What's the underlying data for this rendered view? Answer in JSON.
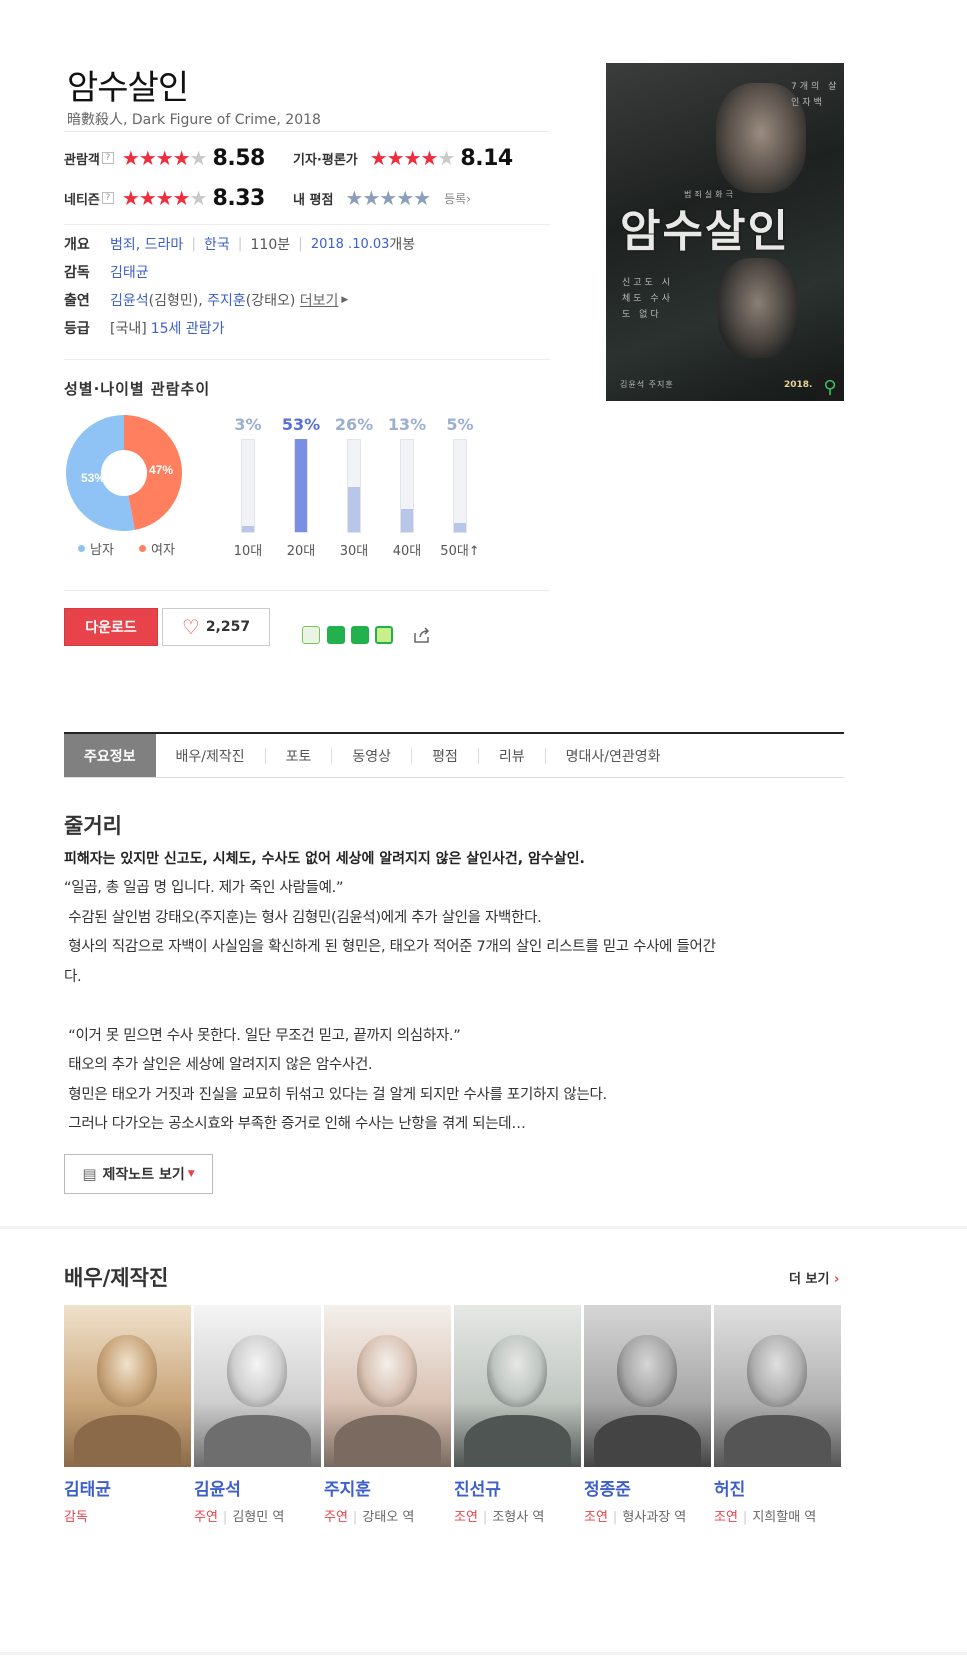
{
  "movie": {
    "title": "암수살인",
    "subtitle": "暗數殺人, Dark Figure of Crime, 2018"
  },
  "ratings": {
    "audience": {
      "label": "관람객",
      "help": "?",
      "stars": 4.3,
      "score": "8.58"
    },
    "critic": {
      "label": "기자·평론가",
      "stars": 4.1,
      "score": "8.14"
    },
    "netizen": {
      "label": "네티즌",
      "help": "?",
      "stars": 4.2,
      "score": "8.33"
    },
    "mine": {
      "label": "내 평점",
      "register": "등록›"
    }
  },
  "info": {
    "overview_label": "개요",
    "genre": "범죄, 드라마",
    "country": "한국",
    "runtime": "110분",
    "release": "2018 .10.03",
    "release_suffix": " 개봉",
    "director_label": "감독",
    "director": "김태균",
    "cast_label": "출연",
    "cast1": "김윤석",
    "cast1_role": "(김형민),",
    "cast2": "주지훈",
    "cast2_role": "(강태오)",
    "cast_more": "더보기",
    "grade_label": "등급",
    "grade_prefix": "[국내]",
    "grade": "15세 관람가"
  },
  "demographics": {
    "title": "성별·나이별 관람추이",
    "gender": {
      "male_pct": 53,
      "female_pct": 47,
      "male_label": "53%",
      "female_label": "47%",
      "male_legend": "남자",
      "female_legend": "여자",
      "male_color": "#8fc3f5",
      "female_color": "#ff7f5f"
    },
    "ages": [
      {
        "label": "10대",
        "pct": 3,
        "pct_label": "3%",
        "top": false
      },
      {
        "label": "20대",
        "pct": 53,
        "pct_label": "53%",
        "top": true
      },
      {
        "label": "30대",
        "pct": 26,
        "pct_label": "26%",
        "top": false
      },
      {
        "label": "40대",
        "pct": 13,
        "pct_label": "13%",
        "top": false
      },
      {
        "label": "50대↑",
        "pct": 5,
        "pct_label": "5%",
        "top": false
      }
    ]
  },
  "actions": {
    "download": "다운로드",
    "likes": "2,257"
  },
  "poster": {
    "title": "암수살인",
    "tagline": "7개의 살인자백",
    "sub": "범죄실화극",
    "lines": "신고도 시체도 수사도 없다",
    "credits": "김윤석 주지훈",
    "year": "2018."
  },
  "tabs": [
    "주요정보",
    "배우/제작진",
    "포토",
    "동영상",
    "평점",
    "리뷰",
    "명대사/연관영화"
  ],
  "synopsis": {
    "title": "줄거리",
    "lead": "피해자는 있지만 신고도, 시체도, 수사도 없어 세상에 알려지지 않은 살인사건, 암수살인.",
    "lines": [
      "“일곱, 총 일곱 명 입니다. 제가 죽인 사람들예.”",
      " 수감된 살인범 강태오(주지훈)는 형사 김형민(김윤석)에게 추가 살인을 자백한다.",
      " 형사의 직감으로 자백이 사실임을 확신하게 된 형민은, 태오가 적어준 7개의 살인 리스트를 믿고 수사에 들어간",
      "다.",
      "",
      " “이거 못 믿으면 수사 못한다. 일단 무조건 믿고, 끝까지 의심하자.”",
      " 태오의 추가 살인은 세상에 알려지지 않은 암수사건.",
      " 형민은 태오가 거짓과 진실을 교묘히 뒤섞고 있다는 걸 알게 되지만 수사를 포기하지 않는다.",
      " 그러나 다가오는 공소시효와 부족한 증거로 인해 수사는 난항을 겪게 되는데…"
    ],
    "note_button": "제작노트 보기"
  },
  "cast_section": {
    "title": "배우/제작진",
    "more": "더 보기",
    "people": [
      {
        "name": "김태균",
        "type": "감독",
        "character": ""
      },
      {
        "name": "김윤석",
        "type": "주연",
        "character": "김형민 역"
      },
      {
        "name": "주지훈",
        "type": "주연",
        "character": "강태오 역"
      },
      {
        "name": "진선규",
        "type": "조연",
        "character": "조형사 역"
      },
      {
        "name": "정종준",
        "type": "조연",
        "character": "형사과장 역"
      },
      {
        "name": "허진",
        "type": "조연",
        "character": "지희할매 역"
      }
    ]
  }
}
